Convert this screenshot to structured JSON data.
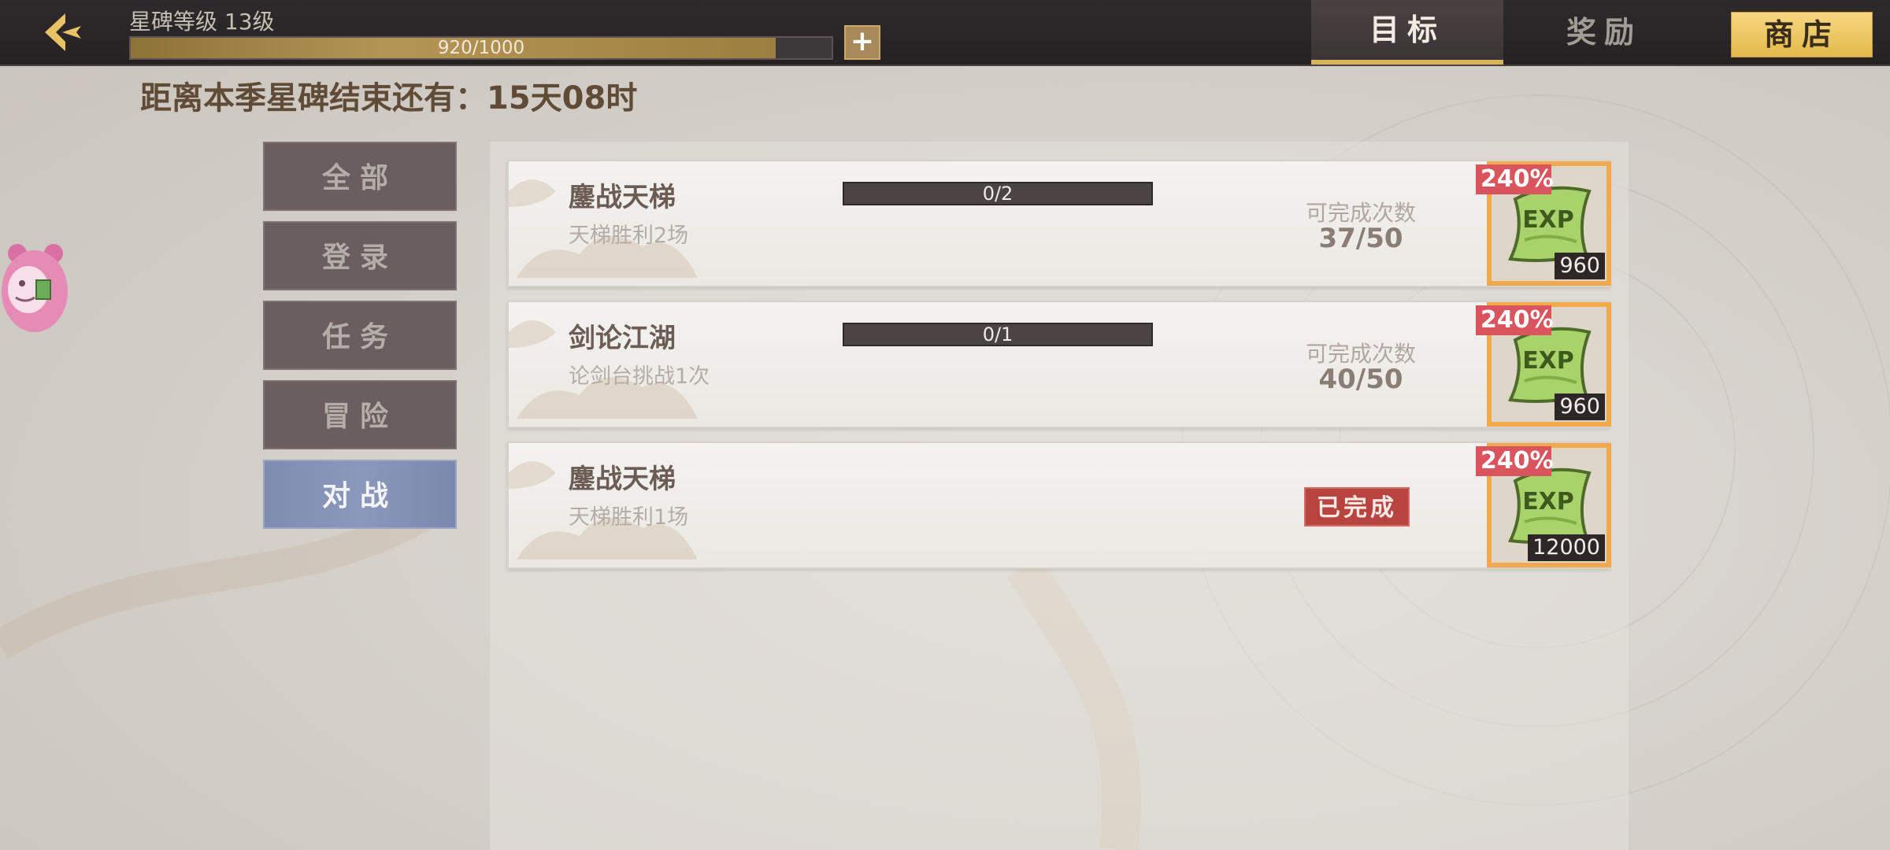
{
  "header": {
    "level_label": "星碑等级 13级",
    "xp_text": "920/1000",
    "xp_progress": 0.92,
    "plus_label": "+",
    "tabs": [
      {
        "label": "目标",
        "active": true
      },
      {
        "label": "奖励",
        "active": false
      }
    ],
    "shop_label": "商店"
  },
  "countdown": "距离本季星碑结束还有：15天08时",
  "categories": [
    {
      "label": "全部",
      "active": false
    },
    {
      "label": "登录",
      "active": false
    },
    {
      "label": "任务",
      "active": false
    },
    {
      "label": "冒险",
      "active": false
    },
    {
      "label": "对战",
      "active": true
    }
  ],
  "tasks": [
    {
      "title": "鏖战天梯",
      "desc": "天梯胜利2场",
      "progress": "0/2",
      "count_label": "可完成次数",
      "count": "37/50",
      "reward_pct": "240%",
      "reward_qty": "960",
      "reward_icon": "exp-scroll-icon"
    },
    {
      "title": "剑论江湖",
      "desc": "论剑台挑战1次",
      "progress": "0/1",
      "count_label": "可完成次数",
      "count": "40/50",
      "reward_pct": "240%",
      "reward_qty": "960",
      "reward_icon": "exp-scroll-icon"
    },
    {
      "title": "鏖战天梯",
      "desc": "天梯胜利1场",
      "status": "已完成",
      "reward_pct": "240%",
      "reward_qty": "12000",
      "reward_icon": "exp-scroll-icon"
    }
  ],
  "colors": {
    "accent_gold": "#d9b45b",
    "active_category": "#8a98bc",
    "reward_border": "#f3a94b",
    "reward_badge": "#d9545c",
    "done_stamp": "#b7443f"
  }
}
